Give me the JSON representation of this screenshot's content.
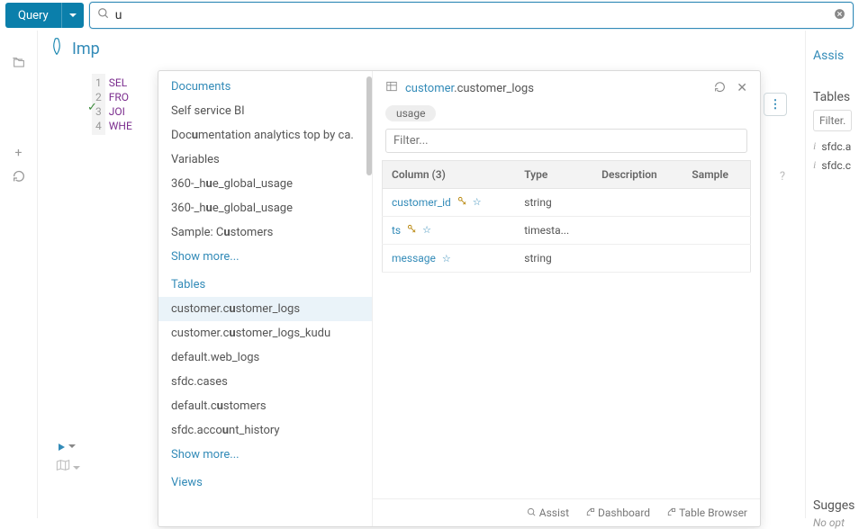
{
  "topbar": {
    "query_label": "Query",
    "search_value": "u"
  },
  "editor": {
    "tab_label": "Imp",
    "lines": [
      "SEL",
      "FRO",
      "JOI",
      "WHE"
    ]
  },
  "dropdown": {
    "sections": {
      "documents": {
        "header": "Documents",
        "items": [
          "Self service BI",
          "Doc<b>u</b>mentation analytics top by ca.",
          "Variables",
          "360-_h<b>u</b>e_global_usage",
          "360-_h<b>u</b>e_global_usage",
          "Sample: C<b>u</b>stomers"
        ],
        "show_more": "Show more..."
      },
      "tables": {
        "header": "Tables",
        "items": [
          "customer.c<b>u</b>stomer_logs",
          "customer.c<b>u</b>stomer_logs_kudu",
          "default.web_logs",
          "sfdc.cases",
          "default.c<b>u</b>stomers",
          "sfdc.acco<b>u</b>nt_history"
        ],
        "selected_index": 0,
        "show_more": "Show more..."
      },
      "views": {
        "header": "Views"
      }
    },
    "preview": {
      "db": "customer",
      "name": ".customer_logs",
      "tag": "usage",
      "filter_placeholder": "Filter...",
      "headers": {
        "column": "Column (3)",
        "type": "Type",
        "description": "Description",
        "sample": "Sample"
      },
      "rows": [
        {
          "name": "customer_id",
          "type": "string",
          "key": true,
          "star": true
        },
        {
          "name": "ts",
          "type": "timesta...",
          "key": true,
          "star": true
        },
        {
          "name": "message",
          "type": "string",
          "key": false,
          "star": true
        }
      ],
      "footer": {
        "assist": "Assist",
        "dashboard": "Dashboard",
        "table_browser": "Table Browser"
      }
    }
  },
  "right_panel": {
    "assist": "Assis",
    "tables_header": "Tables",
    "filter_placeholder": "Filter...",
    "items": [
      "sfdc.a",
      "sfdc.c"
    ],
    "suggest_header": "Sugges",
    "no_options": "No opt"
  }
}
